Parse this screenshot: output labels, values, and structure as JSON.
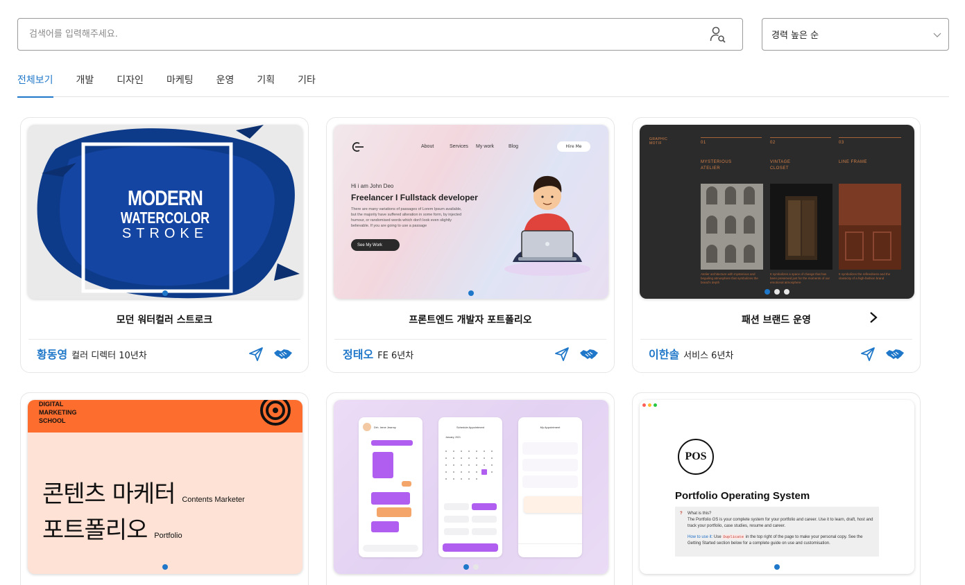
{
  "search": {
    "placeholder": "검색어를 입력해주세요."
  },
  "sort": {
    "selected": "경력 높은 순"
  },
  "tabs": [
    "전체보기",
    "개발",
    "디자인",
    "마케팅",
    "운영",
    "기획",
    "기타"
  ],
  "active_tab": "전체보기",
  "accent_color": "#1f77c9",
  "cards": [
    {
      "title": "모던 워터컬러 스트로크",
      "author": "황동영",
      "role": "컬러 디렉터 10년차",
      "thumb_text": {
        "line1": "MODERN",
        "line2": "WATERCOLOR",
        "line3": "STROKE"
      },
      "dots": 1,
      "active_dot": 1
    },
    {
      "title": "프론트엔드 개발자 포트폴리오",
      "author": "정태오",
      "role": "FE 6년차",
      "thumb_text": {
        "nav": [
          "About",
          "Services",
          "My work",
          "Blog"
        ],
        "hire": "Hire Me",
        "hi": "Hi i am John Deo",
        "headline": "Freelancer I Fullstack developer",
        "body": "There are many variations of passages of Lorem Ipsum available, but the majority have suffered alteration in some form, by injected humour, or randomised words which don't look even slightly believable. If you are going to use a passage",
        "cta": "See My Work"
      },
      "dots": 1,
      "active_dot": 1
    },
    {
      "title": "패션 브랜드 운영",
      "author": "이한솔",
      "role": "서비스 6년차",
      "has_next_arrow": true,
      "thumb_text": {
        "brand": "GRAPHIC MOTIF",
        "cols": [
          {
            "num": "01",
            "name": "MYSTERIOUS ATELIER",
            "caption": "Atelier architecture with mysterious and beguiling atmosphere that symbolizes the brand's depth"
          },
          {
            "num": "02",
            "name": "VINTAGE CLOSET",
            "caption": "It symbolizes a space of change that has been preserved just for the moments of our emotional atmosphere"
          },
          {
            "num": "03",
            "name": "LINE FRAME",
            "caption": "It symbolizes the refinedness and the classicity of a high-fashion brand"
          }
        ]
      },
      "dots": 3,
      "active_dot": 1
    },
    {
      "title": "",
      "author": "",
      "role": "",
      "thumb_text": {
        "school": [
          "DIGITAL",
          "MARKETING",
          "SCHOOL"
        ],
        "line1_ko": "콘텐츠 마케터",
        "line1_en": "Contents Marketer",
        "line2_ko": "포트폴리오",
        "line2_en": "Portfolio"
      },
      "dots": 1,
      "active_dot": 1
    },
    {
      "title": "",
      "author": "",
      "role": "",
      "thumb_text": {
        "screens": [
          "Drh. Irene Jeanny",
          "Schedule Appointment",
          "My Appointment"
        ],
        "month": "January, 2021"
      },
      "dots": 2,
      "active_dot": 1
    },
    {
      "title": "",
      "author": "",
      "role": "",
      "thumb_text": {
        "logo": "POS",
        "title": "Portfolio Operating System",
        "q": "What is this?",
        "desc": "The Portfolio OS is your complete system for your portfolio and career. Use it to learn, draft, host and track your portfolio, case studies, resume and career.",
        "how_label": "How to use it:",
        "how_pre": "Use",
        "how_code": "Duplicate",
        "how_post": "in the top right of the page to make your personal copy. See the Getting Started section below for a complete guide on use and customisation."
      },
      "dots": 1,
      "active_dot": 1
    }
  ]
}
